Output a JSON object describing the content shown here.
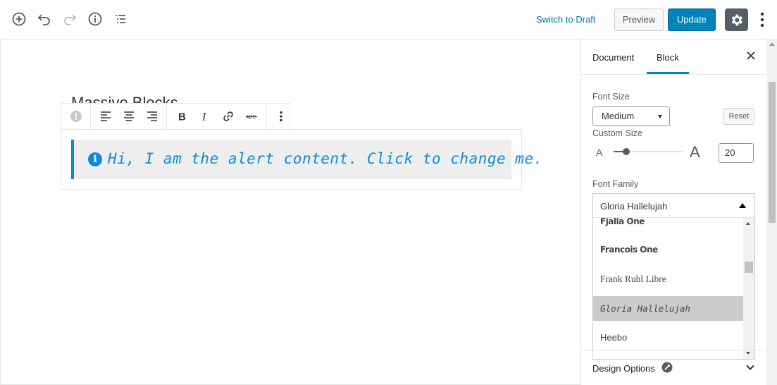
{
  "header": {
    "switch_to_draft": "Switch to Draft",
    "preview_label": "Preview",
    "update_label": "Update"
  },
  "editor": {
    "post_title": "Massive Blocks",
    "alert_icon": "i",
    "alert_text": "Hi, I am the alert content. Click to change me."
  },
  "sidebar": {
    "tab_document": "Document",
    "tab_block": "Block",
    "font_size_label": "Font Size",
    "font_size_value": "Medium",
    "reset_label": "Reset",
    "custom_size_label": "Custom Size",
    "size_small_glyph": "A",
    "size_large_glyph": "A",
    "custom_size_value": "20",
    "slider_fraction": 0.18,
    "font_family_label": "Font Family",
    "font_family_value": "Gloria Hallelujah",
    "font_options": [
      "Fjalla One",
      "Francois One",
      "Frank Ruhl Libre",
      "Gloria Hallelujah",
      "Heebo"
    ],
    "selected_font_option": "Gloria Hallelujah",
    "design_options_label": "Design Options"
  },
  "colors": {
    "accent": "#0085ba",
    "alert_blue": "#0e8bd8",
    "settings_bg": "#555d66"
  }
}
